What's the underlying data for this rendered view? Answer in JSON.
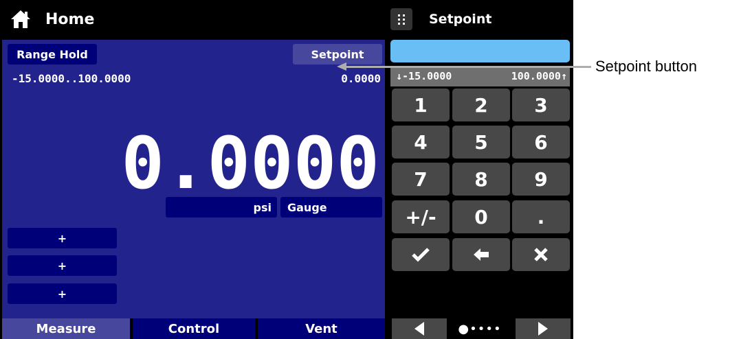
{
  "header": {
    "home_title": "Home",
    "keypad_title": "Setpoint"
  },
  "main": {
    "range_hold_label": "Range Hold",
    "setpoint_button_label": "Setpoint",
    "range_text": "-15.0000..100.0000",
    "setpoint_value": "0.0000",
    "reading": "0.0000",
    "unit": "psi",
    "mode": "Gauge",
    "plus_buttons": [
      "+",
      "+",
      "+"
    ]
  },
  "tabs": [
    "Measure",
    "Control",
    "Vent"
  ],
  "keypad": {
    "min_label": "↓-15.0000",
    "max_label": "100.0000↑",
    "keys": [
      "1",
      "2",
      "3",
      "4",
      "5",
      "6",
      "7",
      "8",
      "9",
      "+/-",
      "0",
      "."
    ],
    "page_dots": "●••••"
  },
  "callout": {
    "label": "Setpoint button"
  },
  "colors": {
    "panel": "#23238e",
    "button_dark": "#000079",
    "button_slate": "#48479e",
    "input": "#69bef5",
    "key": "#484848"
  }
}
